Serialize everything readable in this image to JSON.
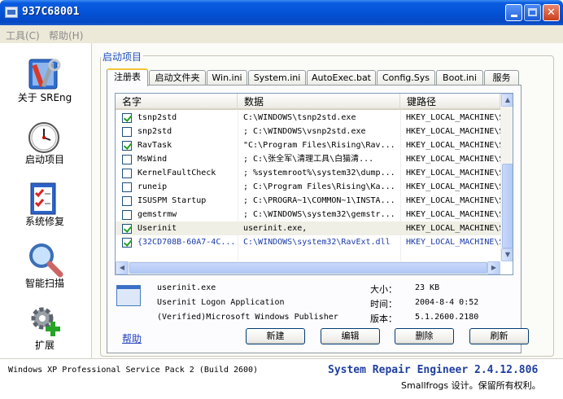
{
  "window": {
    "title": "937C68001"
  },
  "menu": [
    {
      "label": "工具(C)"
    },
    {
      "label": "帮助(H)"
    }
  ],
  "sidebar": {
    "items": [
      {
        "label": "关于 SREng",
        "icon": "tools-icon"
      },
      {
        "label": "启动项目",
        "icon": "clock-icon"
      },
      {
        "label": "系统修复",
        "icon": "checklist-icon"
      },
      {
        "label": "智能扫描",
        "icon": "magnifier-icon"
      },
      {
        "label": "扩展",
        "icon": "gear-plus-icon"
      }
    ]
  },
  "group_title": "启动项目",
  "tabs": [
    "注册表",
    "启动文件夹",
    "Win.ini",
    "System.ini",
    "AutoExec.bat",
    "Config.Sys",
    "Boot.ini",
    "服务"
  ],
  "list": {
    "columns": [
      "名字",
      "数据",
      "键路径"
    ],
    "rows": [
      {
        "checked": true,
        "name": "tsnp2std",
        "data": "C:\\WINDOWS\\tsnp2std.exe",
        "key": "HKEY_LOCAL_MACHINE\\Sof"
      },
      {
        "checked": false,
        "name": "snp2std",
        "data": "; C:\\WINDOWS\\vsnp2std.exe",
        "key": "HKEY_LOCAL_MACHINE\\Sof"
      },
      {
        "checked": true,
        "name": "RavTask",
        "data": "\"C:\\Program Files\\Rising\\Rav...",
        "key": "HKEY_LOCAL_MACHINE\\Sof"
      },
      {
        "checked": false,
        "name": "MsWind",
        "data": "; C:\\张全军\\清理工具\\白猫清...",
        "key": "HKEY_LOCAL_MACHINE\\Sof"
      },
      {
        "checked": false,
        "name": "KernelFaultCheck",
        "data": "; %systemroot%\\system32\\dump...",
        "key": "HKEY_LOCAL_MACHINE\\Sof"
      },
      {
        "checked": false,
        "name": "runeip",
        "data": "; C:\\Program Files\\Rising\\Ka...",
        "key": "HKEY_LOCAL_MACHINE\\Sof"
      },
      {
        "checked": false,
        "name": "ISUSPM Startup",
        "data": "; C:\\PROGRA~1\\COMMON~1\\INSTA...",
        "key": "HKEY_LOCAL_MACHINE\\Sof"
      },
      {
        "checked": false,
        "name": "gemstrmw",
        "data": "; C:\\WINDOWS\\system32\\gemstr...",
        "key": "HKEY_LOCAL_MACHINE\\Sof"
      },
      {
        "checked": true,
        "name": "Userinit",
        "data": "userinit.exe,",
        "key": "HKEY_LOCAL_MACHINE\\Sof"
      },
      {
        "checked": true,
        "name": "{32CD708B-60A7-4C...",
        "data": "C:\\WINDOWS\\system32\\RavExt.dll",
        "key": "HKEY_LOCAL_MACHINE\\SOF"
      }
    ]
  },
  "details": {
    "filename": "userinit.exe",
    "description": "Userinit Logon Application",
    "publisher": "(Verified)Microsoft Windows Publisher",
    "size_label": "大小：",
    "size_value": "23 KB",
    "time_label": "时间：",
    "time_value": "2004-8-4 0:52",
    "version_label": "版本：",
    "version_value": "5.1.2600.2180"
  },
  "actions": {
    "help": "帮助",
    "new": "新建",
    "edit": "编辑",
    "delete": "删除",
    "refresh": "刷新"
  },
  "status": {
    "os": "Windows XP Professional Service Pack 2 (Build 2600)",
    "product": "System Repair Engineer 2.4.12.806",
    "copyright": "Smallfrogs 设计。保留所有权利。"
  },
  "colors": {
    "titlebar": "#0453d6",
    "group_title": "#1f4fbf",
    "status_product": "#1f3f9f"
  }
}
